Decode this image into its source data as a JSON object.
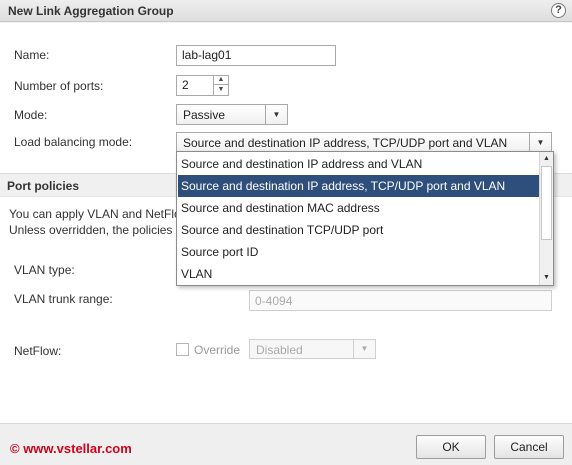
{
  "window": {
    "title": "New Link Aggregation Group",
    "help_glyph": "?"
  },
  "form": {
    "name_label": "Name:",
    "name_value": "lab-lag01",
    "ports_label": "Number of ports:",
    "ports_value": "2",
    "mode_label": "Mode:",
    "mode_value": "Passive",
    "lb_label": "Load balancing mode:",
    "lb_value": "Source and destination IP address, TCP/UDP port and VLAN"
  },
  "dropdown": {
    "options": [
      "Source and destination IP address and VLAN",
      "Source and destination IP address, TCP/UDP port and VLAN",
      "Source and destination MAC address",
      "Source and destination TCP/UDP port",
      "Source port ID",
      "VLAN"
    ],
    "selected_index": 1
  },
  "policies": {
    "header": "Port policies",
    "desc_line1": "You can apply VLAN and NetFlo",
    "desc_line2": "Unless overridden, the policies",
    "vlan_type_label": "VLAN type:",
    "vlan_trunk_label": "VLAN trunk range:",
    "vlan_trunk_value": "0-4094",
    "netflow_label": "NetFlow:",
    "override_label": "Override",
    "netflow_value": "Disabled"
  },
  "footer": {
    "watermark": "© www.vstellar.com",
    "ok_label": "OK",
    "cancel_label": "Cancel"
  },
  "icons": {
    "dropdown_arrow": "▼",
    "stepper_up": "▲",
    "stepper_down": "▼",
    "scroll_up": "▲",
    "scroll_down": "▼"
  },
  "colors": {
    "selection": "#2e4f7c",
    "watermark": "#d0021b"
  }
}
